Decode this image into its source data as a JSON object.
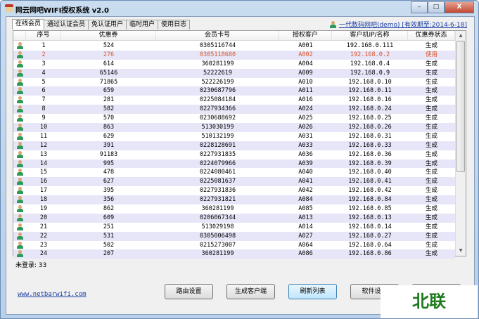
{
  "window": {
    "title": "网云网吧WIFI授权系统 v2.0",
    "minimize": "–",
    "maximize": "□",
    "close": "X"
  },
  "tabs": [
    "在线会员",
    "通过认证会员",
    "免认证用户",
    "临时用户",
    "使用日志"
  ],
  "user_link": "一代数码网吧(demo) [有效期至:2014-6-18]",
  "columns": [
    "序号",
    "优惠券",
    "会员卡号",
    "授权客户",
    "客户机IP/名称",
    "优惠券状态"
  ],
  "rows": [
    [
      "1",
      "524",
      "0305116744",
      "A001",
      "192.168.0.111",
      "生成"
    ],
    [
      "2",
      "276",
      "0305118680",
      "A002",
      "192.168.0.2",
      "使用"
    ],
    [
      "3",
      "614",
      "360281199",
      "A004",
      "192.168.0.4",
      "生成"
    ],
    [
      "4",
      "65146",
      "52222619",
      "A009",
      "192.168.0.9",
      "生成"
    ],
    [
      "5",
      "71865",
      "522226199",
      "A010",
      "192.168.0.10",
      "生成"
    ],
    [
      "6",
      "659",
      "0230687796",
      "A011",
      "192.168.0.11",
      "生成"
    ],
    [
      "7",
      "281",
      "0225084184",
      "A016",
      "192.168.0.16",
      "生成"
    ],
    [
      "8",
      "582",
      "0227934366",
      "A024",
      "192.168.0.24",
      "生成"
    ],
    [
      "9",
      "570",
      "0230688692",
      "A025",
      "192.168.0.25",
      "生成"
    ],
    [
      "10",
      "863",
      "513030199",
      "A026",
      "192.168.0.26",
      "生成"
    ],
    [
      "11",
      "629",
      "510132199",
      "A031",
      "192.168.0.31",
      "生成"
    ],
    [
      "12",
      "391",
      "0228128691",
      "A033",
      "192.168.0.33",
      "生成"
    ],
    [
      "13",
      "91183",
      "0227931835",
      "A036",
      "192.168.0.36",
      "生成"
    ],
    [
      "14",
      "995",
      "0224079966",
      "A039",
      "192.168.0.39",
      "生成"
    ],
    [
      "15",
      "478",
      "0224080461",
      "A040",
      "192.168.0.40",
      "生成"
    ],
    [
      "16",
      "627",
      "0225081637",
      "A041",
      "192.168.0.41",
      "生成"
    ],
    [
      "17",
      "395",
      "0227931836",
      "A042",
      "192.168.0.42",
      "生成"
    ],
    [
      "18",
      "356",
      "0227931821",
      "A084",
      "192.168.0.84",
      "生成"
    ],
    [
      "19",
      "862",
      "360281199",
      "A085",
      "192.168.0.85",
      "生成"
    ],
    [
      "20",
      "609",
      "0206067344",
      "A013",
      "192.168.0.13",
      "生成"
    ],
    [
      "21",
      "251",
      "513029198",
      "A014",
      "192.168.0.14",
      "生成"
    ],
    [
      "22",
      "531",
      "0305006498",
      "A027",
      "192.168.0.27",
      "生成"
    ],
    [
      "23",
      "502",
      "0215273007",
      "A064",
      "192.168.0.64",
      "生成"
    ],
    [
      "24",
      "207",
      "360281199",
      "A086",
      "192.168.0.86",
      "生成"
    ]
  ],
  "highlight_row": 2,
  "status": "未登录: 33",
  "website": "www.netbarwifi.com",
  "buttons": [
    "路由设置",
    "生成客户端",
    "刷新列表",
    "软件设置",
    ""
  ],
  "watermark": "北联"
}
